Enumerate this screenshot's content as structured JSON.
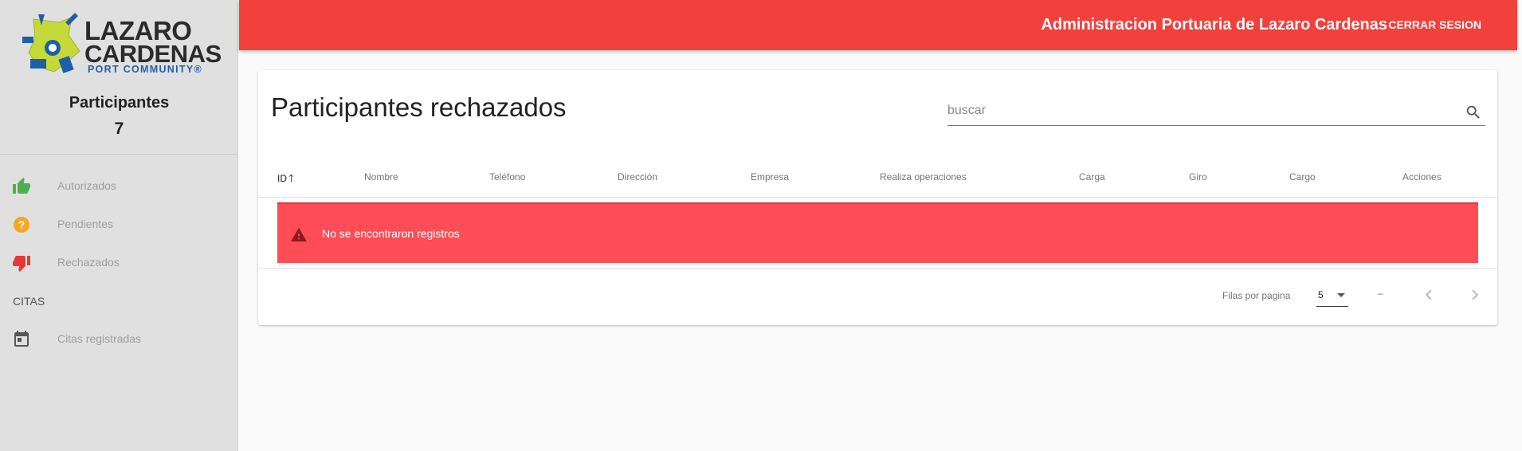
{
  "logo": {
    "line1": "LAZARO",
    "line2": "CARDENAS",
    "line3": "PORT COMMUNITY®"
  },
  "sidebar": {
    "title": "Participantes",
    "count": "7",
    "items": [
      {
        "label": "Autorizados",
        "icon": "thumbs-up-icon",
        "color": "#4caf50"
      },
      {
        "label": "Pendientes",
        "icon": "question-circle-icon",
        "color": "#f5a623"
      },
      {
        "label": "Rechazados",
        "icon": "thumbs-down-icon",
        "color": "#e53935"
      }
    ],
    "section": "CITAS",
    "section_items": [
      {
        "label": "Citas registradas",
        "icon": "calendar-icon",
        "color": "#555555"
      }
    ]
  },
  "topbar": {
    "title": "Administracion Portuaria de Lazaro Cardenas",
    "logout": "CERRAR SESION",
    "color": "#f2403d"
  },
  "main": {
    "title": "Participantes rechazados",
    "search": {
      "placeholder": "buscar",
      "value": ""
    },
    "columns": [
      "ID",
      "Nombre",
      "Teléfono",
      "Dirección",
      "Empresa",
      "Realiza operaciones",
      "Carga",
      "Giro",
      "Cargo",
      "Acciones"
    ],
    "sort_column": "ID",
    "sort_direction": "ascending",
    "empty_message": "No se encontraron registros",
    "alert_color": "#fe4d57",
    "pagination": {
      "rows_label": "Filas por pagina",
      "rows_per_page": "5",
      "range": "–"
    }
  }
}
